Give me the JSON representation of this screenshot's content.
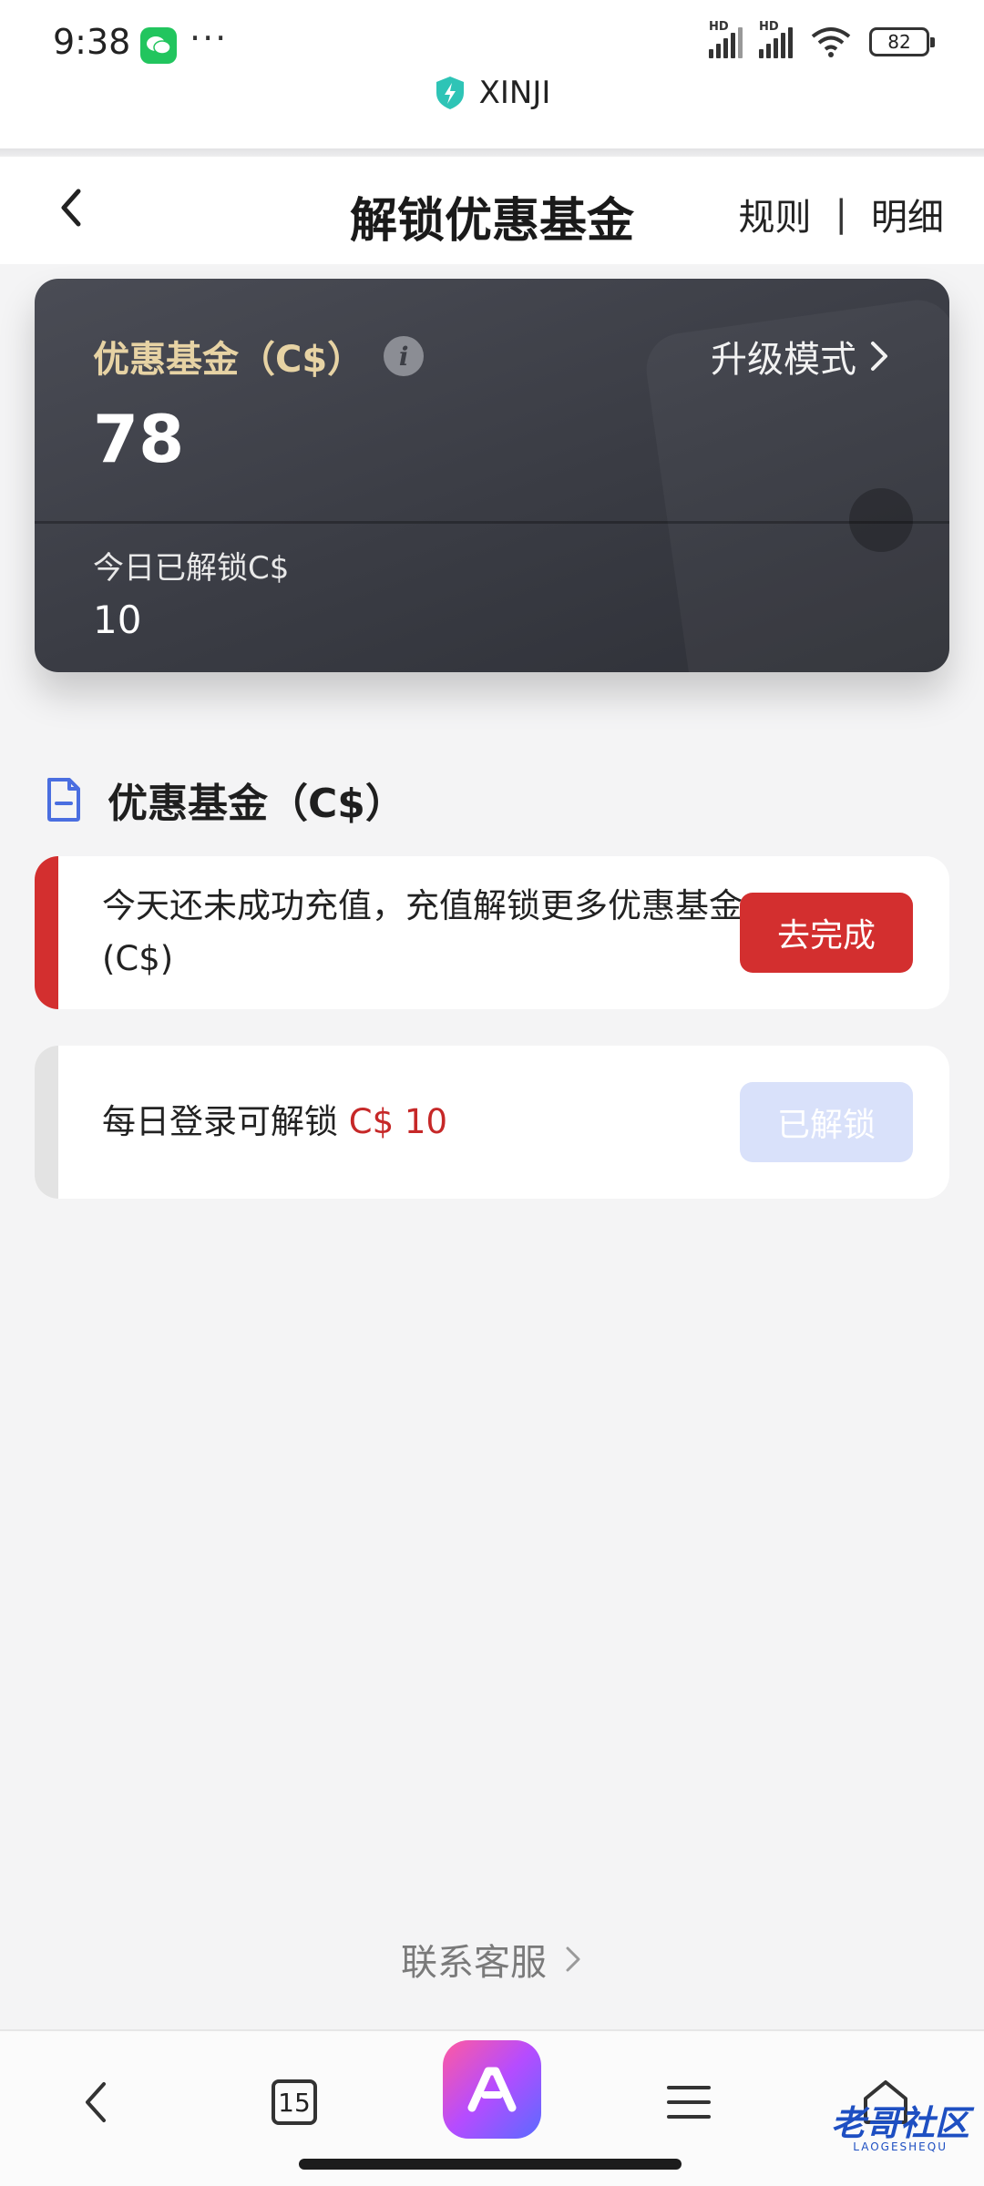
{
  "status_bar": {
    "time": "9:38",
    "more": "···",
    "battery": "82",
    "site_name": "XINJI",
    "hd_label": "HD"
  },
  "header": {
    "title": "解锁优惠基金",
    "rules": "规则",
    "separator": "|",
    "details": "明细"
  },
  "card": {
    "label": "优惠基金（C$）",
    "info_glyph": "i",
    "upgrade": "升级模式",
    "value": "78",
    "today_label": "今日已解锁C$",
    "today_value": "10"
  },
  "section": {
    "title": "优惠基金（C$）"
  },
  "tasks": [
    {
      "text": "今天还未成功充值，充值解锁更多优惠基金 (C$)",
      "button": "去完成",
      "bar_color": "#d32f2f",
      "button_color": "#d32f2f"
    },
    {
      "text_prefix": "每日登录可解锁 ",
      "amount": "C$ 10",
      "button": "已解锁",
      "bar_color": "#e3e3e3",
      "button_color": "#d9e1fa"
    }
  ],
  "contact": {
    "label": "联系客服"
  },
  "bottom_nav": {
    "tabs_count": "15",
    "icons": [
      "back-icon",
      "tabs-icon",
      "app-logo-icon",
      "menu-icon",
      "home-icon"
    ]
  },
  "watermark": {
    "text": "老哥社区",
    "sub": "LAOGESHEQU"
  }
}
